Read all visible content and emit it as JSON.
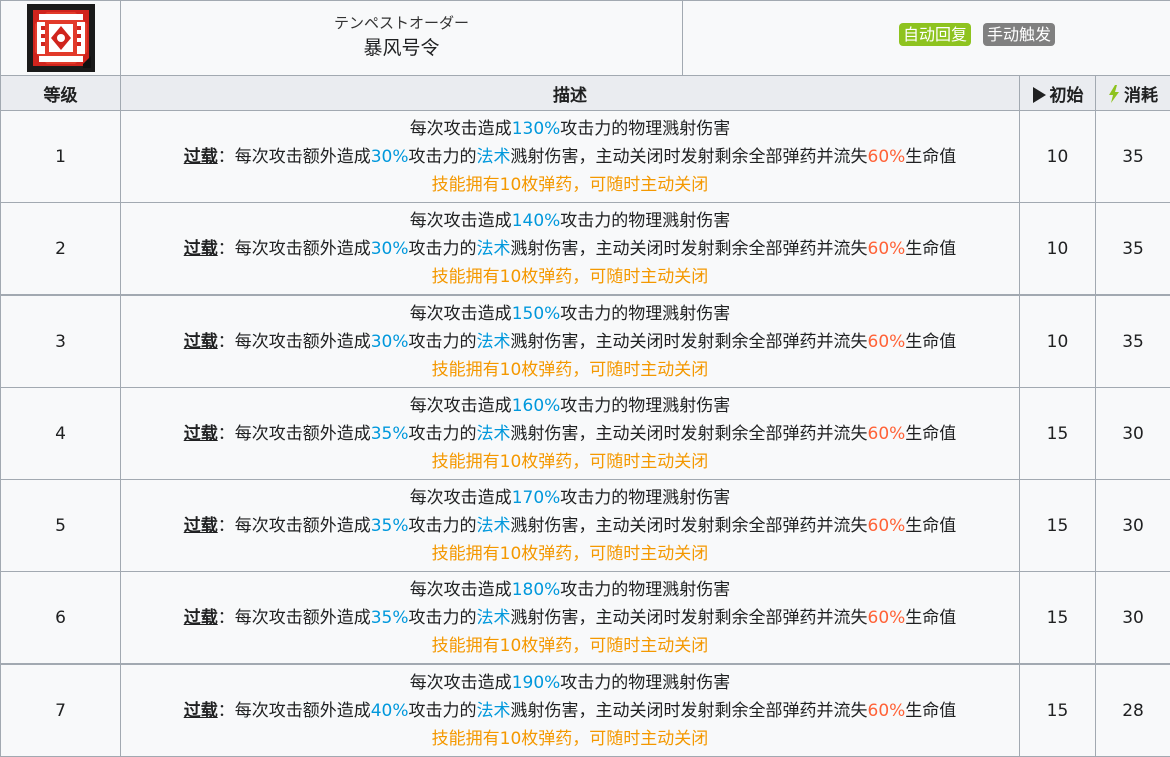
{
  "skill": {
    "kana": "テンペストオーダー",
    "name": "暴风号令",
    "tags": [
      {
        "label": "自动回复",
        "color": "#8ec31f"
      },
      {
        "label": "手动触发",
        "color": "#808080"
      }
    ],
    "icon": "skill-emblem-icon"
  },
  "columns": {
    "level": "等级",
    "description": "描述",
    "initial": "初始",
    "cost": "消耗",
    "initial_icon": "play-triangle-icon",
    "cost_icon": "lightning-bolt-icon"
  },
  "text": {
    "line1_prefix": "每次攻击造成",
    "line1_suffix": "攻击力的物理溅射伤害",
    "overload_keyword": "过载",
    "line2_colon": "：每次攻击额外造成",
    "line2_mid": "攻击力的",
    "line2_arts": "法术",
    "line2_tail": "溅射伤害，主动关闭时发射剩余全部弹药并流失",
    "line2_hp_pct": "60%",
    "line2_end": "生命值",
    "line3": "技能拥有10枚弹药，可随时主动关闭"
  },
  "levels": [
    {
      "level": "1",
      "atk": "130%",
      "arts": "30%",
      "initial": "10",
      "cost": "35"
    },
    {
      "level": "2",
      "atk": "140%",
      "arts": "30%",
      "initial": "10",
      "cost": "35"
    },
    {
      "level": "3",
      "atk": "150%",
      "arts": "30%",
      "initial": "10",
      "cost": "35"
    },
    {
      "level": "4",
      "atk": "160%",
      "arts": "35%",
      "initial": "15",
      "cost": "30"
    },
    {
      "level": "5",
      "atk": "170%",
      "arts": "35%",
      "initial": "15",
      "cost": "30"
    },
    {
      "level": "6",
      "atk": "180%",
      "arts": "35%",
      "initial": "15",
      "cost": "30"
    },
    {
      "level": "7",
      "atk": "190%",
      "arts": "40%",
      "initial": "15",
      "cost": "28"
    }
  ]
}
